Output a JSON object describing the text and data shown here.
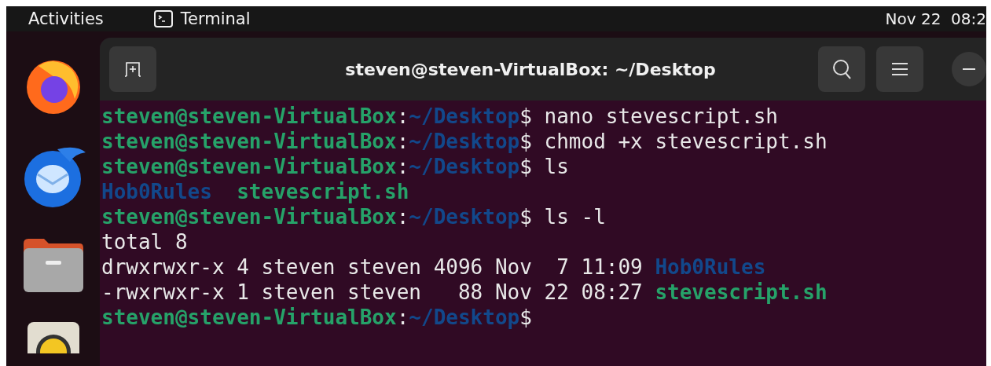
{
  "top_bar": {
    "activities": "Activities",
    "app_name": "Terminal",
    "clock": "Nov 22  08:2"
  },
  "dock": {
    "items": [
      {
        "kind": "firefox"
      },
      {
        "kind": "thunderbird"
      },
      {
        "kind": "files"
      },
      {
        "kind": "rhythmbox"
      }
    ]
  },
  "window": {
    "title": "steven@steven-VirtualBox: ~/Desktop"
  },
  "terminal": {
    "lines": [
      [
        {
          "text": "steven@steven-VirtualBox",
          "kind": "user"
        },
        {
          "text": ":",
          "kind": "plain"
        },
        {
          "text": "~/Desktop",
          "kind": "path"
        },
        {
          "text": "$ nano stevescript.sh",
          "kind": "plain"
        }
      ],
      [
        {
          "text": "steven@steven-VirtualBox",
          "kind": "user"
        },
        {
          "text": ":",
          "kind": "plain"
        },
        {
          "text": "~/Desktop",
          "kind": "path"
        },
        {
          "text": "$ chmod +x stevescript.sh",
          "kind": "plain"
        }
      ],
      [
        {
          "text": "steven@steven-VirtualBox",
          "kind": "user"
        },
        {
          "text": ":",
          "kind": "plain"
        },
        {
          "text": "~/Desktop",
          "kind": "path"
        },
        {
          "text": "$ ls",
          "kind": "plain"
        }
      ],
      [
        {
          "text": "Hob0Rules",
          "kind": "dir"
        },
        {
          "text": "stevescript.sh",
          "kind": "exec"
        }
      ],
      [
        {
          "text": "steven@steven-VirtualBox",
          "kind": "user"
        },
        {
          "text": ":",
          "kind": "plain"
        },
        {
          "text": "~/Desktop",
          "kind": "path"
        },
        {
          "text": "$ ls -l",
          "kind": "plain"
        }
      ],
      [
        {
          "text": "total 8",
          "kind": "plain"
        }
      ],
      [
        {
          "text": "drwxrwxr-x 4 steven steven 4096 Nov  7 11:09 ",
          "kind": "plain"
        },
        {
          "text": "Hob0Rules",
          "kind": "dir"
        }
      ],
      [
        {
          "text": "-rwxrwxr-x 1 steven steven   88 Nov 22 08:27 ",
          "kind": "plain"
        },
        {
          "text": "stevescript.sh",
          "kind": "exec"
        }
      ],
      [
        {
          "text": "steven@steven-VirtualBox",
          "kind": "user"
        },
        {
          "text": ":",
          "kind": "plain"
        },
        {
          "text": "~/Desktop",
          "kind": "path"
        },
        {
          "text": "$",
          "kind": "plain"
        }
      ]
    ]
  }
}
